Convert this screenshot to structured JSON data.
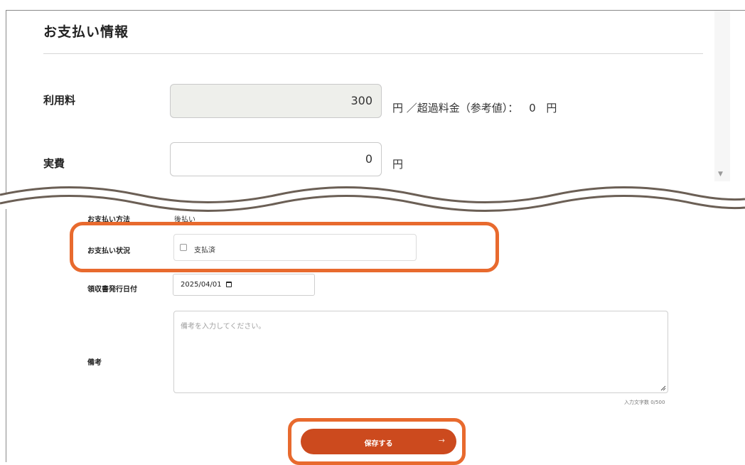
{
  "payment_section": {
    "title": "お支払い情報",
    "fee_label": "利用料",
    "fee_value": "300",
    "fee_unit_note": "円 ／超過料金（参考値）：",
    "overage_value": "0",
    "overage_unit": "円",
    "actual_label": "実費",
    "actual_value": "0",
    "actual_unit": "円"
  },
  "lower_form": {
    "method_label": "お支払い方法",
    "method_value": "後払い",
    "status_label": "お支払い状況",
    "status_checkbox_label": "支払済",
    "status_checked": false,
    "receipt_date_label": "領収書発行日付",
    "receipt_date_value": "2025/04/01",
    "remarks_label": "備考",
    "remarks_placeholder": "備考を入力してください。",
    "char_counter": "入力文字数 0/500",
    "save_label": "保存する",
    "save_arrow": "→"
  },
  "colors": {
    "highlight": "#e86a2e",
    "save_button": "#cc4a1e",
    "disabled_field": "#eeefeb"
  },
  "icons": [
    "calendar-icon",
    "arrow-right-icon",
    "resize-handle-icon",
    "scroll-down-icon"
  ]
}
